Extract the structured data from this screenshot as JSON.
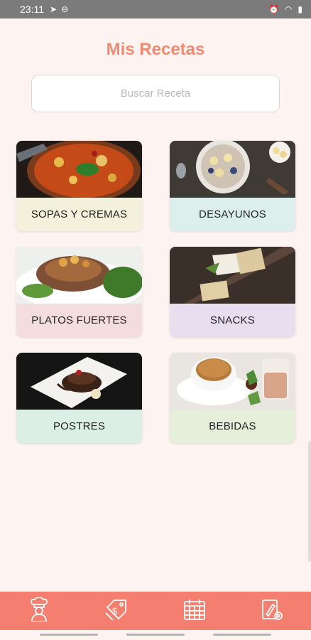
{
  "status": {
    "time": "23:11"
  },
  "app": {
    "title": "Mis Recetas"
  },
  "search": {
    "placeholder": "Buscar Receta"
  },
  "categories": [
    {
      "label": "SOPAS Y CREMAS",
      "color": "#f3f0dc"
    },
    {
      "label": "DESAYUNOS",
      "color": "#dcefed"
    },
    {
      "label": "PLATOS FUERTES",
      "color": "#f3dedd"
    },
    {
      "label": "SNACKS",
      "color": "#e7dff0"
    },
    {
      "label": "POSTRES",
      "color": "#dcefe6"
    },
    {
      "label": "BEBIDAS",
      "color": "#e6efda"
    }
  ],
  "nav": [
    "chef-icon",
    "price-tag-icon",
    "calendar-icon",
    "settings-edit-icon"
  ],
  "colors": {
    "accent": "#f47f70",
    "title": "#f08a73",
    "background": "#fdf4f1"
  }
}
